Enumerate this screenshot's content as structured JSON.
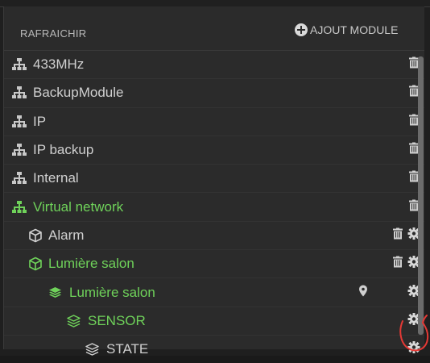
{
  "header": {
    "refresh_label": "RAFRAICHIR",
    "add_module_label": "AJOUT MODULE"
  },
  "colors": {
    "green": "#6fd25a",
    "text": "#d0d0d0",
    "annotation": "#e53935"
  },
  "networks": [
    {
      "label": "433MHz",
      "icon": "network-icon"
    },
    {
      "label": "BackupModule",
      "icon": "network-icon"
    },
    {
      "label": "IP",
      "icon": "network-icon"
    },
    {
      "label": "IP backup",
      "icon": "network-icon"
    },
    {
      "label": "Internal",
      "icon": "network-icon"
    },
    {
      "label": "Virtual network",
      "icon": "network-icon"
    }
  ],
  "tree": [
    {
      "label": "Alarm",
      "icon": "cube-icon"
    },
    {
      "label": "Lumière salon",
      "icon": "cube-icon"
    },
    {
      "label": "Lumière salon",
      "icon": "layers-icon"
    },
    {
      "label": "SENSOR",
      "icon": "layers-icon"
    },
    {
      "label": "STATE",
      "icon": "layers-icon"
    }
  ]
}
